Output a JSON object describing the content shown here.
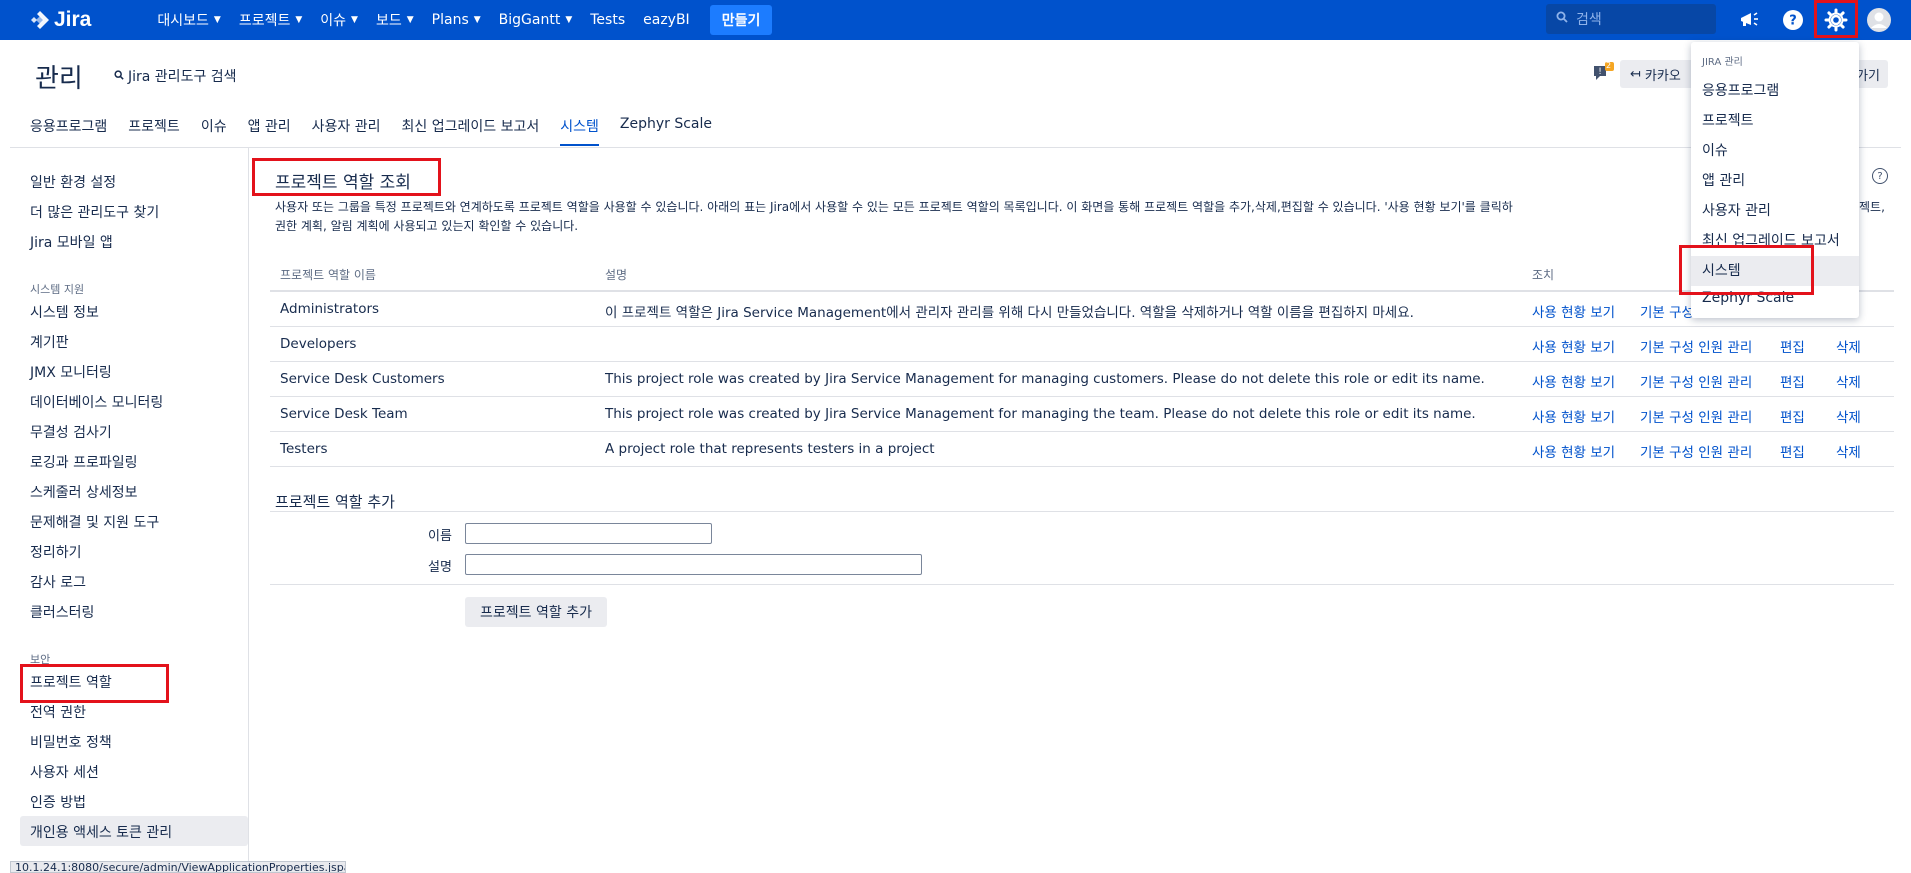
{
  "topnav": {
    "logo": "Jira",
    "items": [
      {
        "label": "대시보드",
        "dropdown": true
      },
      {
        "label": "프로젝트",
        "dropdown": true
      },
      {
        "label": "이슈",
        "dropdown": true
      },
      {
        "label": "보드",
        "dropdown": true
      },
      {
        "label": "Plans",
        "dropdown": true
      },
      {
        "label": "BigGantt",
        "dropdown": true
      },
      {
        "label": "Tests",
        "dropdown": false
      },
      {
        "label": "eazyBI",
        "dropdown": false
      }
    ],
    "create_label": "만들기",
    "search_placeholder": "검색",
    "icons": [
      "megaphone-icon",
      "help-icon",
      "gear-icon",
      "avatar"
    ]
  },
  "header": {
    "title": "관리",
    "admin_search": "Jira 관리도구 검색",
    "feedback_badge": "2",
    "kakao_label": "카카오",
    "back_label": "가기"
  },
  "tabs": [
    {
      "label": "응용프로그램",
      "active": false
    },
    {
      "label": "프로젝트",
      "active": false
    },
    {
      "label": "이슈",
      "active": false
    },
    {
      "label": "앱 관리",
      "active": false
    },
    {
      "label": "사용자 관리",
      "active": false
    },
    {
      "label": "최신 업그레이드 보고서",
      "active": false
    },
    {
      "label": "시스템",
      "active": true
    },
    {
      "label": "Zephyr Scale",
      "active": false
    }
  ],
  "sidebar": {
    "group1": [
      "일반 환경 설정",
      "더 많은 관리도구 찾기",
      "Jira 모바일 앱"
    ],
    "support_heading": "시스템 지원",
    "group2": [
      "시스템 정보",
      "계기판",
      "JMX 모니터링",
      "데이터베이스 모니터링",
      "무결성 검사기",
      "로깅과 프로파일링",
      "스케줄러 상세정보",
      "문제해결 및 지원 도구",
      "정리하기",
      "감사 로그",
      "클러스터링"
    ],
    "security_heading": "보안",
    "group3": [
      "프로젝트 역할",
      "전역 권한",
      "비밀번호 정책",
      "사용자 세션",
      "인증 방법",
      "개인용 액세스 토큰 관리"
    ]
  },
  "content": {
    "title": "프로젝트 역할 조회",
    "description_line1": "사용자 또는 그룹을 특정 프로젝트와 연계하도록 프로젝트 역할을 사용할 수 있습니다. 아래의 표는 Jira에서 사용할 수 있는 모든 프로젝트 역할의 목록입니다. 이 화면을 통해 프로젝트 역할을 추가,삭제,편집할 수 있습니다. '사용 현황 보기'를 클릭하",
    "description_line1_tail": "젝트,",
    "description_line2": "권한 계획, 알림 계획에 사용되고 있는지 확인할 수 있습니다.",
    "table": {
      "headers": {
        "name": "프로젝트 역할 이름",
        "description": "설명",
        "actions": "조치"
      },
      "rows": [
        {
          "name": "Administrators",
          "description": "이 프로젝트 역할은 Jira Service Management에서 관리자 관리를 위해 다시 만들었습니다. 역할을 삭제하거나 역할 이름을 편집하지 마세요.",
          "view_usage": "사용 현황 보기",
          "default_members": "기본 구성"
        },
        {
          "name": "Developers",
          "description": "",
          "view_usage": "사용 현황 보기",
          "default_members": "기본 구성 인원 관리",
          "edit": "편집",
          "delete": "삭제"
        },
        {
          "name": "Service Desk Customers",
          "description": "This project role was created by Jira Service Management for managing customers. Please do not delete this role or edit its name.",
          "view_usage": "사용 현황 보기",
          "default_members": "기본 구성 인원 관리",
          "edit": "편집",
          "delete": "삭제"
        },
        {
          "name": "Service Desk Team",
          "description": "This project role was created by Jira Service Management for managing the team. Please do not delete this role or edit its name.",
          "view_usage": "사용 현황 보기",
          "default_members": "기본 구성 인원 관리",
          "edit": "편집",
          "delete": "삭제"
        },
        {
          "name": "Testers",
          "description": "A project role that represents testers in a project",
          "view_usage": "사용 현황 보기",
          "default_members": "기본 구성 인원 관리",
          "edit": "편집",
          "delete": "삭제"
        }
      ]
    },
    "add_section": {
      "title": "프로젝트 역할 추가",
      "name_label": "이름",
      "description_label": "설명",
      "name_value": "",
      "description_value": "",
      "submit_label": "프로젝트 역할 추가"
    }
  },
  "admin_dropdown": {
    "heading": "JIRA 관리",
    "items": [
      {
        "label": "응용프로그램",
        "active": false
      },
      {
        "label": "프로젝트",
        "active": false
      },
      {
        "label": "이슈",
        "active": false
      },
      {
        "label": "앱 관리",
        "active": false
      },
      {
        "label": "사용자 관리",
        "active": false
      },
      {
        "label": "최신 업그레이드 보고서",
        "active": false
      },
      {
        "label": "시스템",
        "active": true
      },
      {
        "label": "Zephyr Scale",
        "active": false
      }
    ]
  },
  "statusbar": {
    "url": "10.1.24.1:8080/secure/admin/ViewApplicationProperties.jspa"
  },
  "colors": {
    "nav_bg": "#0052cc",
    "accent": "#0052cc",
    "create_button": "#1c7cff",
    "highlight": "#e3121b"
  }
}
